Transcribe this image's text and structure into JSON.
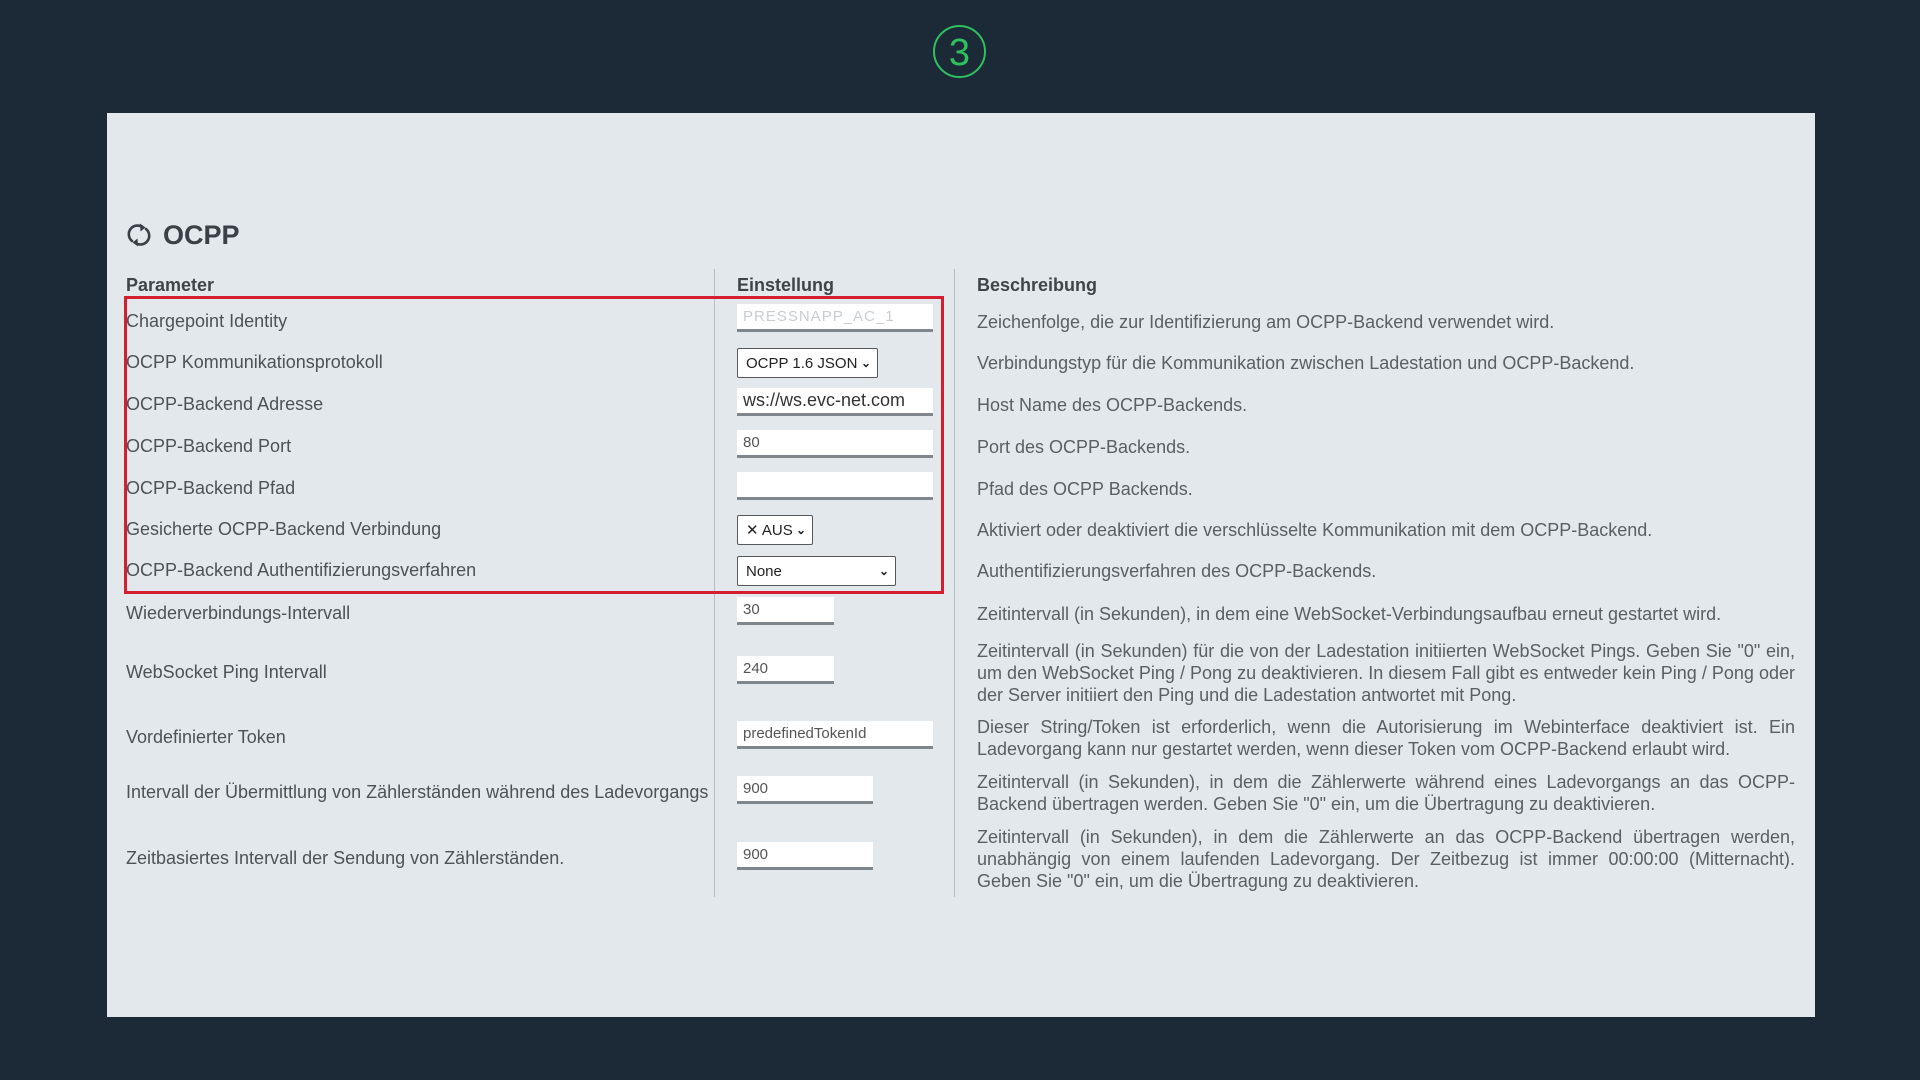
{
  "step": {
    "number": "3",
    "color": "#2fc160"
  },
  "section": {
    "title": "OCPP",
    "icon": "refresh-icon"
  },
  "columns": {
    "parameter": "Parameter",
    "setting": "Einstellung",
    "description": "Beschreibung"
  },
  "highlight_color": "#d51e30",
  "rows": [
    {
      "label": "Chargepoint Identity",
      "value": "PRESSNAPP_AC_1",
      "type": "text-blurred",
      "description": "Zeichenfolge, die zur Identifizierung am OCPP-Backend verwendet wird."
    },
    {
      "label": "OCPP Kommunikationsprotokoll",
      "value": "OCPP 1.6 JSON",
      "type": "select",
      "description": "Verbindungstyp für die Kommunikation zwischen Ladestation und OCPP-Backend."
    },
    {
      "label": "OCPP-Backend Adresse",
      "value": "ws://ws.evc-net.com",
      "type": "text",
      "description": "Host Name des OCPP-Backends."
    },
    {
      "label": "OCPP-Backend Port",
      "value": "80",
      "type": "text",
      "description": "Port des OCPP-Backends."
    },
    {
      "label": "OCPP-Backend Pfad",
      "value": "",
      "type": "text",
      "description": "Pfad des OCPP Backends."
    },
    {
      "label": "Gesicherte OCPP-Backend Verbindung",
      "value": "✕ AUS",
      "type": "select",
      "description": "Aktiviert oder deaktiviert die verschlüsselte Kommunikation mit dem OCPP-Backend."
    },
    {
      "label": "OCPP-Backend Authentifizierungsverfahren",
      "value": "None",
      "type": "select",
      "description": "Authentifizierungsverfahren des OCPP-Backends."
    },
    {
      "label": "Wiederverbindungs-Intervall",
      "value": "30",
      "type": "text",
      "description": "Zeitintervall (in Sekunden), in dem eine WebSocket-Verbindungsaufbau erneut gestartet wird."
    },
    {
      "label": "WebSocket Ping Intervall",
      "value": "240",
      "type": "text",
      "description": "Zeitintervall (in Sekunden) für die von der Ladestation initiierten WebSocket Pings. Geben Sie \"0\" ein, um den WebSocket Ping / Pong zu deaktivieren. In diesem Fall gibt es entweder kein Ping / Pong oder der Server initiiert den Ping und die Ladestation antwortet mit Pong."
    },
    {
      "label": "Vordefinierter Token",
      "value": "predefinedTokenId",
      "type": "text",
      "description": "Dieser String/Token ist erforderlich, wenn die Autorisierung im Webinterface deaktiviert ist. Ein Ladevorgang kann nur gestartet werden, wenn dieser Token vom OCPP-Backend erlaubt wird."
    },
    {
      "label": "Intervall der Übermittlung von Zählerständen während des Ladevorgangs",
      "value": "900",
      "type": "text",
      "description": "Zeitintervall (in Sekunden), in dem die Zählerwerte während eines Ladevorgangs an das OCPP-Backend übertragen werden. Geben Sie \"0\" ein, um die Übertragung zu deaktivieren."
    },
    {
      "label": "Zeitbasiertes Intervall der Sendung von Zählerständen.",
      "value": "900",
      "type": "text",
      "description": "Zeitintervall (in Sekunden), in dem die Zählerwerte an das OCPP-Backend übertragen werden, unabhängig von einem laufenden Ladevorgang. Der Zeitbezug ist immer 00:00:00 (Mitternacht). Geben Sie \"0\" ein, um die Übertragung zu deaktivieren."
    }
  ]
}
